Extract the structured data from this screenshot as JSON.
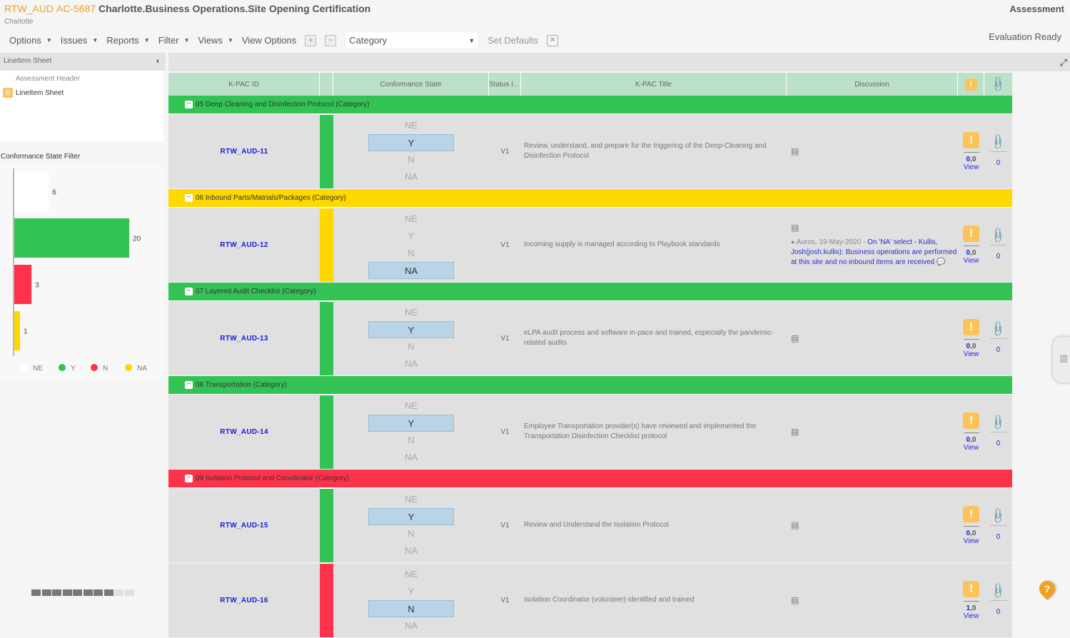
{
  "header": {
    "prefix": "RTW_AUD",
    "code": "AC-5687",
    "title": "Charlotte.Business Operations.Site Opening Certification",
    "subtitle": "Charlotte",
    "right_label": "Assessment",
    "status": "Evaluation Ready"
  },
  "toolbar": {
    "menus": [
      "Options",
      "Issues",
      "Reports",
      "Filter",
      "Views"
    ],
    "view_options": "View Options",
    "expand_icon": "plus-box-icon",
    "collapse_icon": "minus-box-icon",
    "group_by": "Category",
    "set_defaults": "Set Defaults",
    "clear_icon": "close-box-icon"
  },
  "left_panel": {
    "header": "LineItem Sheet",
    "tree": [
      "Assessment Header",
      "LineItem Sheet"
    ],
    "filter_title": "Conformance State Filter"
  },
  "chart_data": {
    "type": "bar",
    "orientation": "horizontal",
    "title": "Conformance State Filter",
    "categories": [
      "NE",
      "Y",
      "N",
      "NA"
    ],
    "values": [
      6,
      20,
      3,
      1
    ],
    "colors": [
      "#ffffff",
      "#33c355",
      "#ff324b",
      "#ffd800"
    ],
    "legend": [
      "NE",
      "Y",
      "N",
      "NA"
    ],
    "legend_position": "bottom",
    "xlim": [
      0,
      20
    ]
  },
  "pager": {
    "filled": 8,
    "total": 10
  },
  "grid": {
    "columns": [
      "K-PAC ID",
      "",
      "Conformance State",
      "Status I...",
      "K-PAC Title",
      "Discussion",
      "",
      ""
    ],
    "state_options": [
      "NE",
      "Y",
      "N",
      "NA"
    ],
    "colors": {
      "Y": "#33c355",
      "N": "#ff324b",
      "NA": "#ffd800"
    },
    "groups": [
      {
        "label": "05 Deep Cleaning and Disinfection Protocol (Category)",
        "color": "#33c355",
        "items": [
          {
            "id": "RTW_AUD-11",
            "state": "Y",
            "status": "V1",
            "title": "Review, understand, and prepare for the triggering of the Deep-Cleaning and Disinfection Protocol",
            "discussion": "",
            "warn_count": "0",
            "warn_count2": ",0",
            "view": "View",
            "attachments": "0"
          }
        ]
      },
      {
        "label": "06 Inbound Parts/Matrials/Packages (Category)",
        "color": "#ffd800",
        "items": [
          {
            "id": "RTW_AUD-12",
            "state": "NA",
            "status": "V1",
            "title": "Incoming supply is managed according to Playbook standards",
            "discussion_meta": "Auros, 19-May-2020 - ",
            "discussion": "On 'NA' select - Kullis, Josh(josh.kullis): Business operations are performed at this site and no inbound items are received",
            "warn_count": "0",
            "warn_count2": ",0",
            "view": "View",
            "attachments": "0"
          }
        ]
      },
      {
        "label": "07 Layered Audit Checklist (Category)",
        "color": "#33c355",
        "items": [
          {
            "id": "RTW_AUD-13",
            "state": "Y",
            "status": "V1",
            "title": "eLPA audit process and software in-pace and trained, especially the pandemic-related audits",
            "discussion": "",
            "warn_count": "0",
            "warn_count2": ",0",
            "view": "View",
            "attachments": "0"
          }
        ]
      },
      {
        "label": "08 Transportation (Category)",
        "color": "#33c355",
        "items": [
          {
            "id": "RTW_AUD-14",
            "state": "Y",
            "status": "V1",
            "title": "Employee Transportation provider(s) have reviewed and implemented the Transportation Disinfection Checklist protocol",
            "discussion": "",
            "warn_count": "0",
            "warn_count2": ",0",
            "view": "View",
            "attachments": "0"
          }
        ]
      },
      {
        "label": "09 Isolation Protocol and Coordinator (Category)",
        "color": "#ff324b",
        "items": [
          {
            "id": "RTW_AUD-15",
            "state": "Y",
            "status": "V1",
            "title": "Review and Understand the Isolation Protocol",
            "discussion": "",
            "warn_count": "0",
            "warn_count2": ",0",
            "view": "View",
            "attachments": "0"
          },
          {
            "id": "RTW_AUD-16",
            "state": "N",
            "status": "V1",
            "title": "Isolation Coordinator (volunteer) identified and trained",
            "discussion": "",
            "warn_count": "1",
            "warn_count2": ",0",
            "view": "View",
            "attachments": "0"
          }
        ]
      }
    ]
  },
  "help_label": "?"
}
